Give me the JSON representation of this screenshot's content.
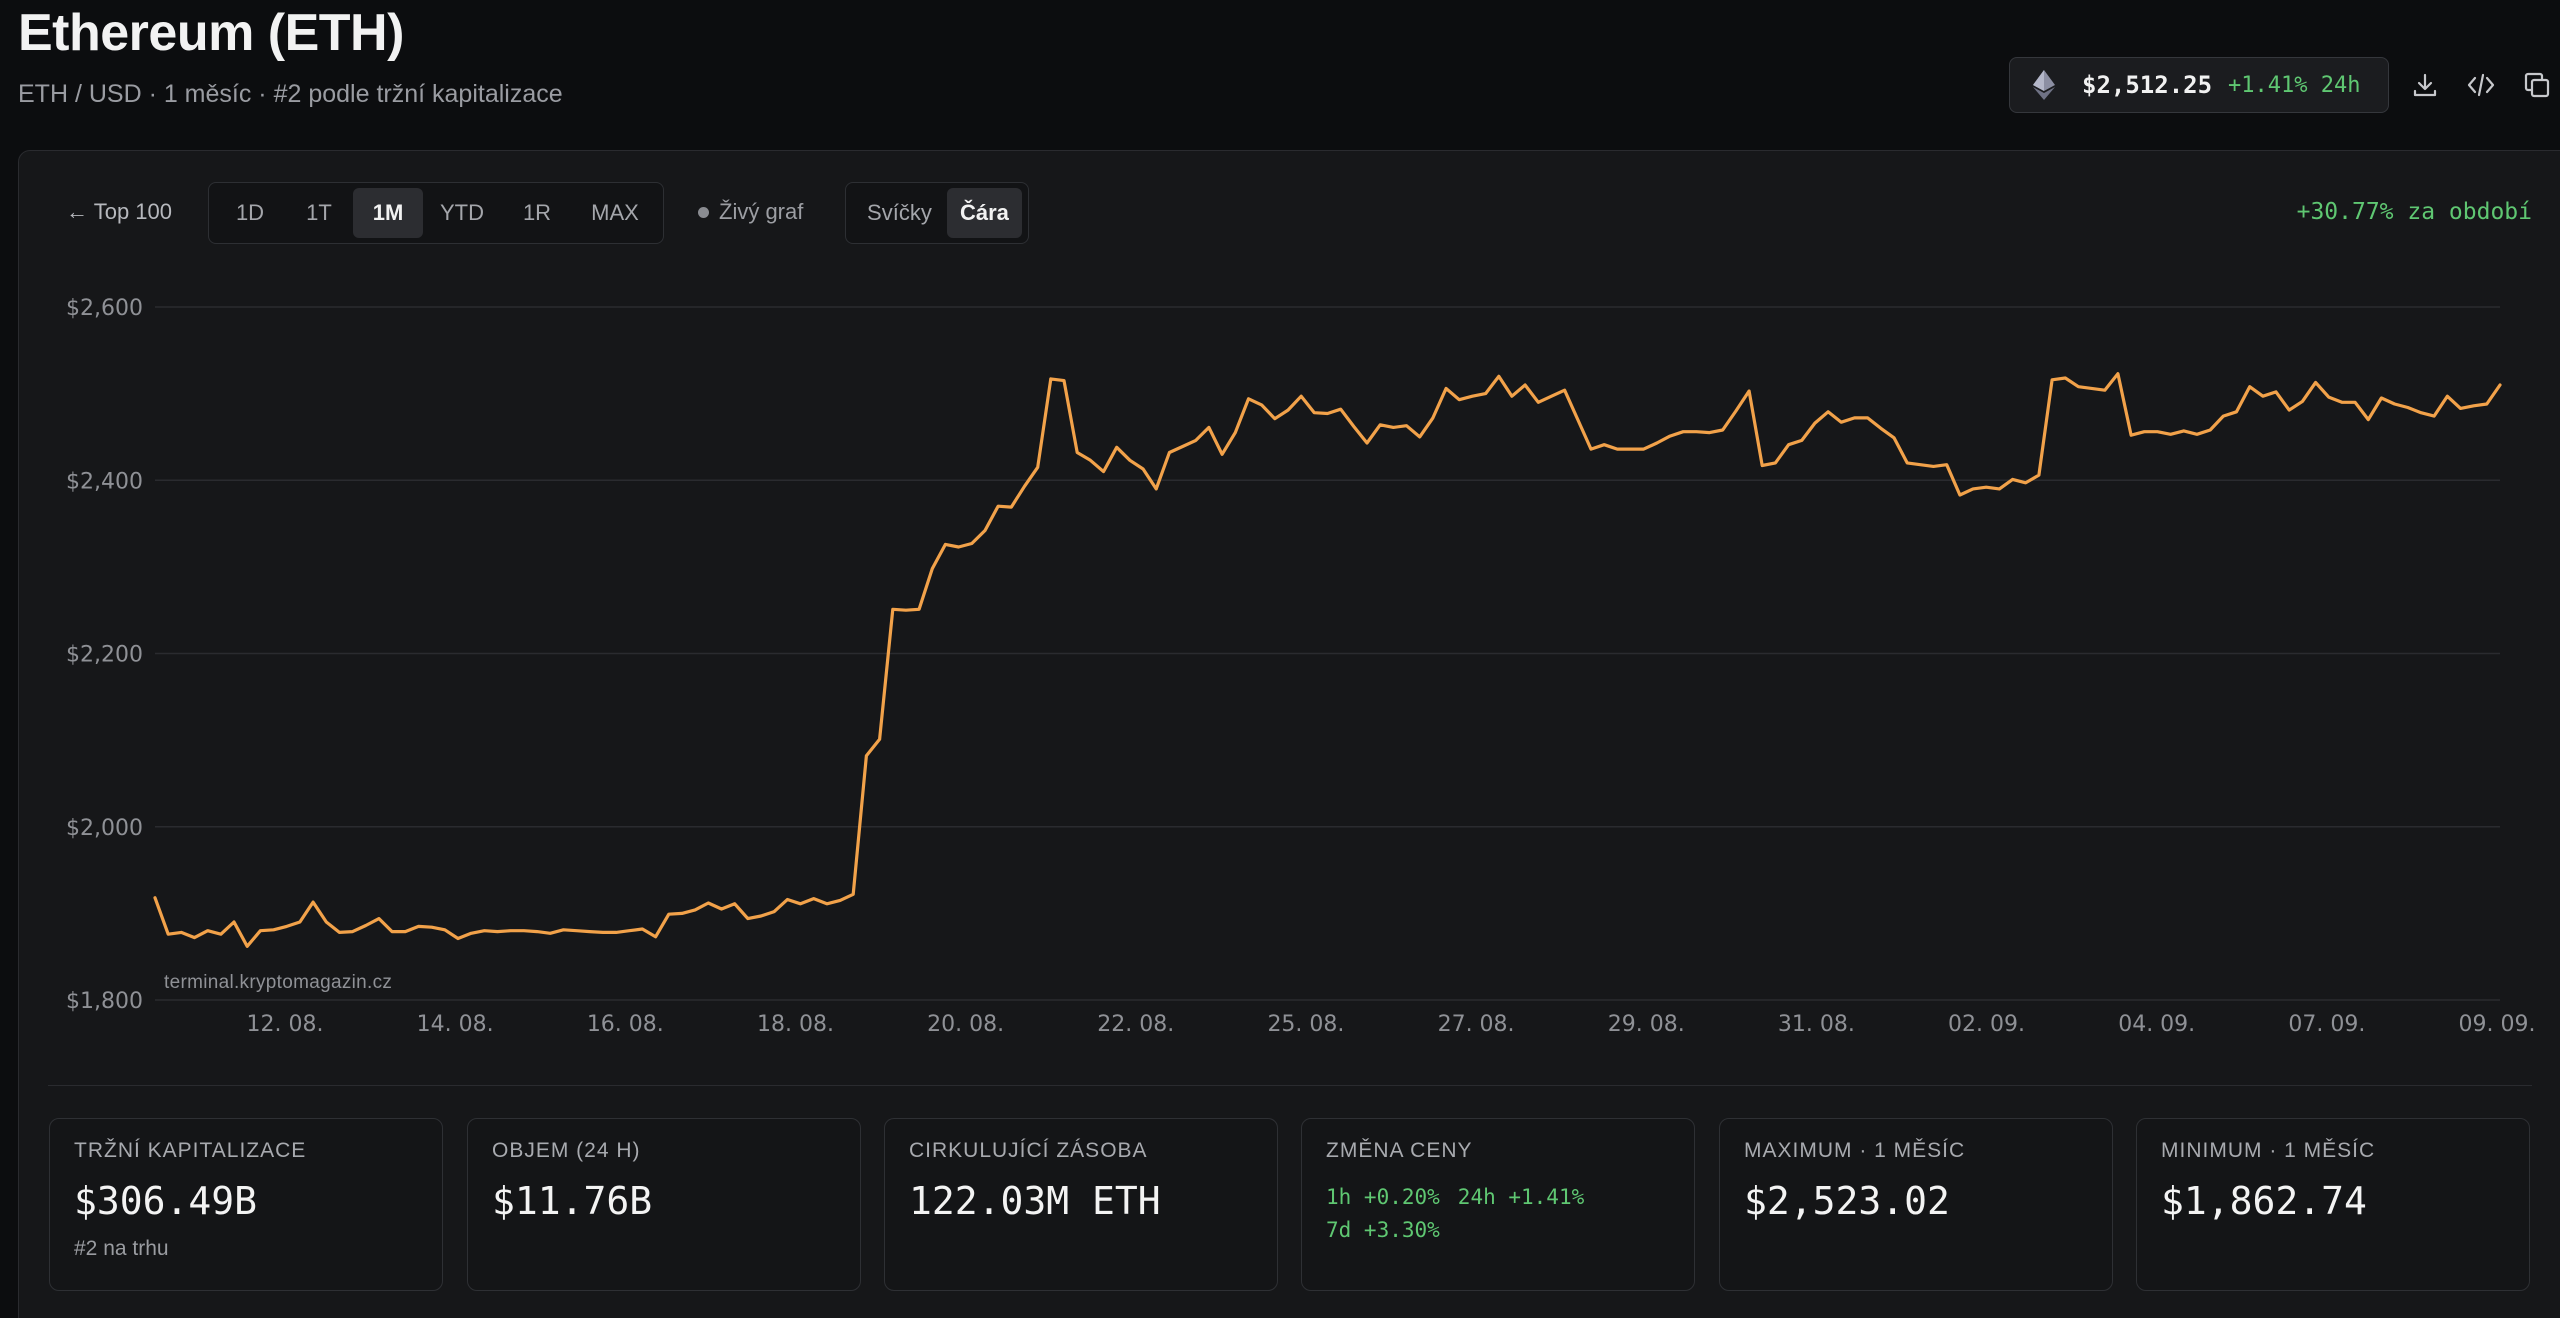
{
  "header": {
    "title": "Ethereum (ETH)",
    "subtitle": "ETH / USD · 1 měsíc · #2 podle tržní kapitalizace"
  },
  "ticker": {
    "price": "$2,512.25",
    "change": "+1.41% 24h",
    "icon": "ethereum-icon"
  },
  "toolbar": {
    "icons": [
      "download-icon",
      "code-icon",
      "copy-icon"
    ]
  },
  "controls": {
    "back_label": "← Top 100",
    "ranges": [
      "1D",
      "1T",
      "1M",
      "YTD",
      "1R",
      "MAX"
    ],
    "active_range": "1M",
    "live_label": "Živý graf",
    "modes": [
      "Svíčky",
      "Čára"
    ],
    "active_mode": "Čára",
    "period_change": "+30.77% za období"
  },
  "colors": {
    "line": "#f2a24a",
    "positive": "#5fc772"
  },
  "chart_data": {
    "type": "line",
    "x_tick_labels": [
      "12. 08.",
      "14. 08.",
      "16. 08.",
      "18. 08.",
      "20. 08.",
      "22. 08.",
      "25. 08.",
      "27. 08.",
      "29. 08.",
      "31. 08.",
      "02. 09.",
      "04. 09.",
      "07. 09.",
      "09. 09."
    ],
    "y_ticks": [
      1800,
      2000,
      2200,
      2400,
      2600
    ],
    "y_tick_labels": [
      "$1,800",
      "$2,000",
      "$2,200",
      "$2,400",
      "$2,600"
    ],
    "ylim": [
      1800,
      2600
    ],
    "grid": true,
    "watermark": "terminal.kryptomagazin.cz",
    "values": [
      1918,
      1876,
      1878,
      1872,
      1880,
      1876,
      1890,
      1862,
      1880,
      1881,
      1885,
      1890,
      1913,
      1890,
      1878,
      1879,
      1886,
      1894,
      1879,
      1879,
      1885,
      1884,
      1881,
      1871,
      1877,
      1880,
      1879,
      1880,
      1880,
      1879,
      1877,
      1881,
      1880,
      1879,
      1878,
      1878,
      1880,
      1882,
      1873,
      1899,
      1900,
      1904,
      1912,
      1905,
      1911,
      1894,
      1897,
      1902,
      1916,
      1911,
      1917,
      1911,
      1915,
      1922,
      2082,
      2101,
      2251,
      2250,
      2251,
      2298,
      2326,
      2323,
      2327,
      2342,
      2370,
      2369,
      2393,
      2415,
      2517,
      2515,
      2432,
      2423,
      2410,
      2438,
      2423,
      2413,
      2390,
      2432,
      2439,
      2446,
      2461,
      2430,
      2455,
      2494,
      2487,
      2471,
      2481,
      2497,
      2478,
      2477,
      2482,
      2462,
      2443,
      2464,
      2461,
      2463,
      2450,
      2472,
      2506,
      2493,
      2497,
      2500,
      2520,
      2497,
      2510,
      2490,
      2497,
      2504,
      2470,
      2436,
      2441,
      2436,
      2436,
      2436,
      2443,
      2451,
      2456,
      2456,
      2455,
      2458,
      2480,
      2503,
      2417,
      2420,
      2441,
      2446,
      2466,
      2479,
      2467,
      2472,
      2472,
      2460,
      2449,
      2420,
      2418,
      2416,
      2418,
      2383,
      2390,
      2392,
      2390,
      2401,
      2397,
      2406,
      2516,
      2518,
      2508,
      2506,
      2504,
      2523,
      2452,
      2456,
      2456,
      2453,
      2457,
      2453,
      2458,
      2474,
      2479,
      2508,
      2497,
      2502,
      2481,
      2491,
      2513,
      2496,
      2490,
      2490,
      2470,
      2495,
      2488,
      2484,
      2478,
      2474,
      2497,
      2483,
      2486,
      2488,
      2510
    ]
  },
  "stats": [
    {
      "label": "TRŽNÍ KAPITALIZACE",
      "value": "$306.49B",
      "sub": "#2 na trhu"
    },
    {
      "label": "OBJEM (24 H)",
      "value": "$11.76B"
    },
    {
      "label": "CIRKULUJÍCÍ ZÁSOBA",
      "value": "122.03M ETH"
    },
    {
      "label": "ZMĚNA CENY",
      "changes": [
        "1h +0.20%",
        "24h +1.41%",
        "7d +3.30%"
      ]
    },
    {
      "label": "MAXIMUM · 1 MĚSÍC",
      "value": "$2,523.02"
    },
    {
      "label": "MINIMUM · 1 MĚSÍC",
      "value": "$1,862.74"
    }
  ]
}
